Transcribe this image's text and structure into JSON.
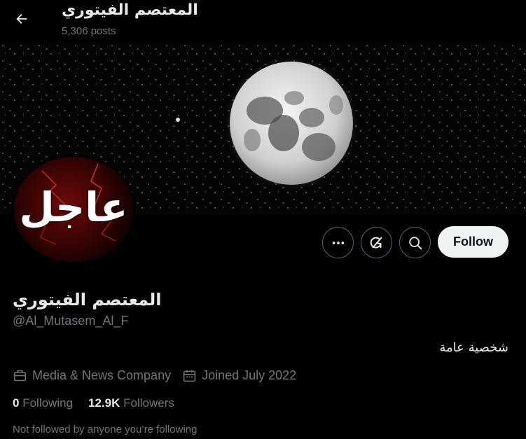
{
  "header": {
    "title": "المعتصم الفيتوري",
    "posts_count": "5,306 posts"
  },
  "avatar": {
    "text": "عاجل"
  },
  "actions": {
    "follow_label": "Follow"
  },
  "profile": {
    "display_name": "المعتصم الفيتوري",
    "handle": "@Al_Mutasem_Al_F",
    "bio": "شخصية عامة",
    "category": "Media & News Company",
    "joined": "Joined July 2022",
    "following_count": "0",
    "following_label": "Following",
    "followers_count": "12.9K",
    "followers_label": "Followers",
    "followed_by_note": "Not followed by anyone you’re following"
  },
  "icons": {
    "back": "arrow-left-icon",
    "more": "more-dots-icon",
    "grok": "grok-icon",
    "search": "search-icon",
    "category": "briefcase-icon",
    "joined": "calendar-icon"
  },
  "colors": {
    "background": "#000000",
    "text_primary": "#e7e9ea",
    "text_secondary": "#71767b",
    "border": "#536471",
    "follow_bg": "#eff3f4",
    "follow_text": "#0f1419"
  }
}
